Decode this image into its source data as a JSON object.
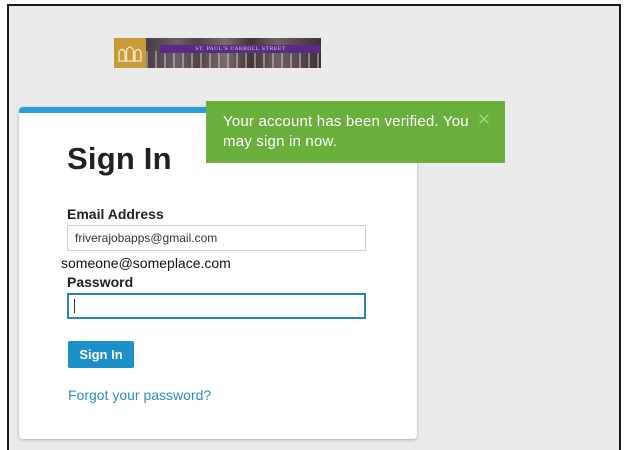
{
  "banner": {
    "logo_icon": "cathedral-logo-icon",
    "caption": "ST. PAUL'S CARROLL STREET",
    "colors": {
      "logo": "#c79a3a",
      "strip": "#5a2a86"
    }
  },
  "toast": {
    "message": "Your account has been verified. You may sign in now.",
    "close_icon": "close-icon",
    "color": "#6aaf3c"
  },
  "form": {
    "title": "Sign In",
    "email_label": "Email Address",
    "email_value": "friverajobapps@gmail.com",
    "email_overlay": "someone@someplace.com",
    "password_label": "Password",
    "password_value": "",
    "submit_label": "Sign In",
    "forgot_link": "Forgot your password?",
    "accent_color": "#2a9fd6"
  }
}
